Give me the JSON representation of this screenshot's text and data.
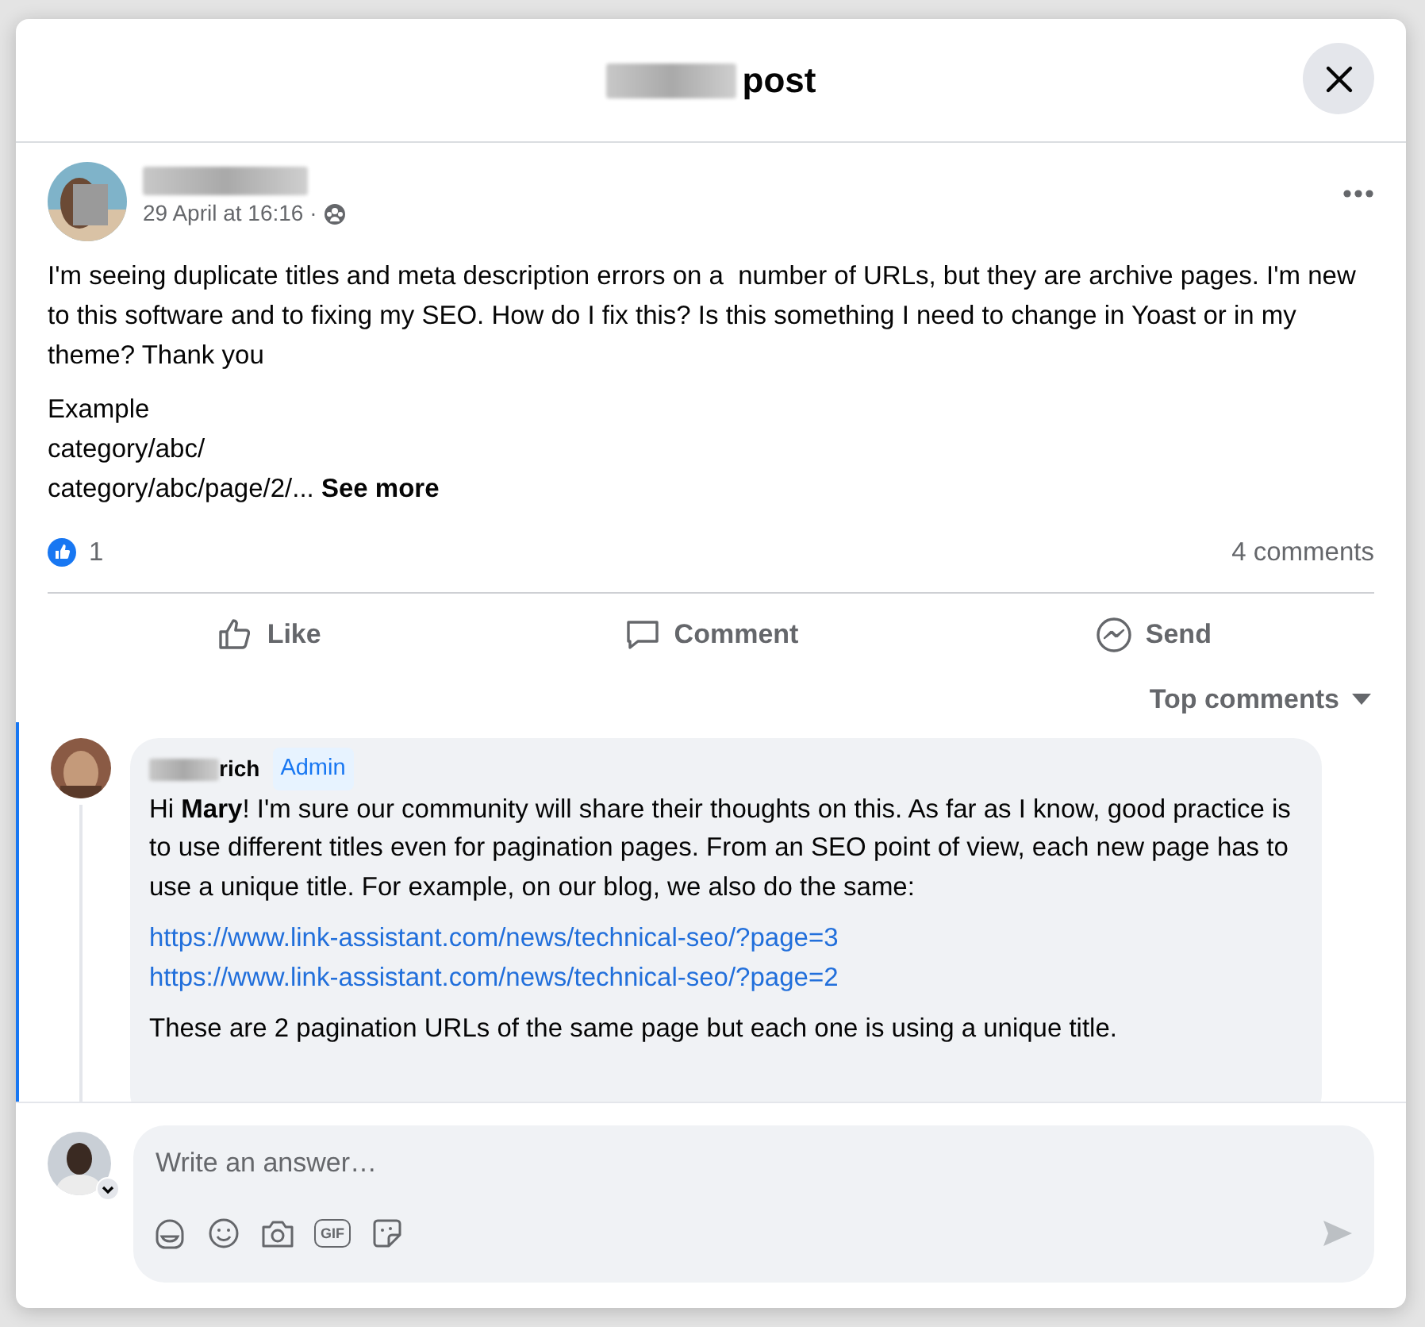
{
  "dialog": {
    "title": "post"
  },
  "post": {
    "time": "29 April at 16:16 ·",
    "paragraphs": [
      "I'm seeing duplicate titles and meta description errors on a  number of URLs, but they are archive pages. I'm new to this software and to fixing my SEO. How do I fix this? Is this something I need to change in Yoast or in my theme? Thank you",
      "Example\ncategory/abc/\ncategory/abc/page/2/..."
    ],
    "see_more": "See more",
    "reactions_count": "1",
    "comments_count": "4 comments"
  },
  "actions": [
    {
      "kind": "like",
      "label": "Like"
    },
    {
      "kind": "comment",
      "label": "Comment"
    },
    {
      "kind": "send",
      "label": "Send"
    }
  ],
  "sort": {
    "label": "Top comments"
  },
  "comments": [
    {
      "name": "rich",
      "badge": "Admin",
      "selected": true,
      "paragraphs": [
        {
          "kind": "text",
          "text": "Hi **Mary**! I'm sure our community will share their thoughts on this. As far as I know, good practice is to use different titles even for pagination pages. From an SEO point of view, each new page has to use a unique title. For example, on our blog, we also do the same:"
        },
        {
          "kind": "links",
          "links": [
            "https://www.link-assistant.com/news/technical-seo/?page=3",
            "https://www.link-assistant.com/news/technical-seo/?page=2"
          ]
        },
        {
          "kind": "text",
          "text": "These are 2 pagination URLs of the same page but each one is using a unique title."
        }
      ]
    }
  ],
  "composer": {
    "placeholder": "Write an answer…",
    "tools": [
      {
        "kind": "avatar-sticker"
      },
      {
        "kind": "emoji"
      },
      {
        "kind": "camera"
      },
      {
        "kind": "gif",
        "label": "GIF"
      },
      {
        "kind": "sticker"
      }
    ]
  }
}
